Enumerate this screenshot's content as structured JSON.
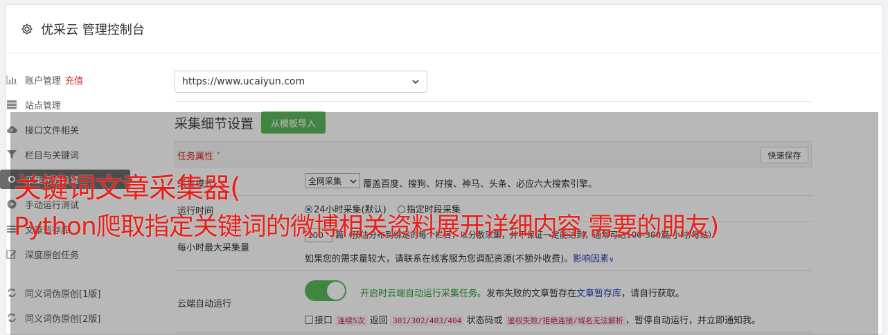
{
  "header": {
    "title": "优采云 管理控制台",
    "icon": "gear-icon"
  },
  "sidebar": {
    "items": [
      {
        "label": "账户管理",
        "extra": "充值",
        "icon": "bar-chart-icon"
      },
      {
        "label": "站点管理",
        "icon": "server-icon"
      },
      {
        "label": "接口文件相关",
        "icon": "cloud-upload-icon"
      },
      {
        "label": "栏目与关键词",
        "icon": "filter-icon"
      },
      {
        "label": "采集任务设置",
        "icon": "gear-icon"
      },
      {
        "label": "手动运行测试",
        "icon": "play-icon"
      },
      {
        "label": "文章暂存库",
        "icon": "list-icon"
      },
      {
        "label": "深度原创任务",
        "icon": "edit-icon"
      },
      {
        "label": "同义词伪原创[1版]",
        "icon": "refresh-icon"
      },
      {
        "label": "同义词伪原创[2版]",
        "icon": "refresh-icon"
      }
    ]
  },
  "site_select": {
    "value": "https://www.ucaiyun.com"
  },
  "section": {
    "title": "采集细节设置",
    "template_button": "从模板导入"
  },
  "table": {
    "task_attr": "任务属性",
    "quick_save": "快速保存",
    "rows": {
      "mode": {
        "label": "采集模式",
        "select_value": "全网采集",
        "desc": "覆盖百度、搜狗、好搜、神马、头条、必应六大搜索引擎。"
      },
      "run_time": {
        "label": "运行时间",
        "opt1": "24小时采集(默认)",
        "opt2": "指定时段采集"
      },
      "max_per_hour": {
        "label": "每小时最大采集量",
        "input_value": "100",
        "line1": "篇（预估分布到绑定的每个栏目，以分散采集，并不保证一定能达到，通常可达100-300篇/小时/每站）",
        "line2": "如果您的需求量较大，请联系在线客服为您调配资源(不额外收费)。",
        "link": "影响因素"
      },
      "cloud_run": {
        "label": "云端自动运行",
        "toggle_on": true,
        "green_text": "开启时云端自动运行采集任务。",
        "desc_a": "发布失败的文章暂存在",
        "desc_link": "文章暂存库",
        "desc_b": "，请自行获取。",
        "cb_label": "接口",
        "code1": "连续5次",
        "mid1": "返回",
        "code2": "301/302/403/404",
        "mid2": "状态码或",
        "code3": "鉴权失败/拒绝连接/域名无法解析",
        "tail": "，暂停自动运行，并立即通知我。"
      }
    }
  },
  "banner": {
    "line1": "关键词文章采集器(",
    "line2": "Python爬取指定关键词的微博相关资料展开详细内容,需要的朋友)"
  },
  "colors": {
    "accent_green": "#5cb85c",
    "alert_red": "#e8201a",
    "link_blue": "#1a3fb0"
  }
}
